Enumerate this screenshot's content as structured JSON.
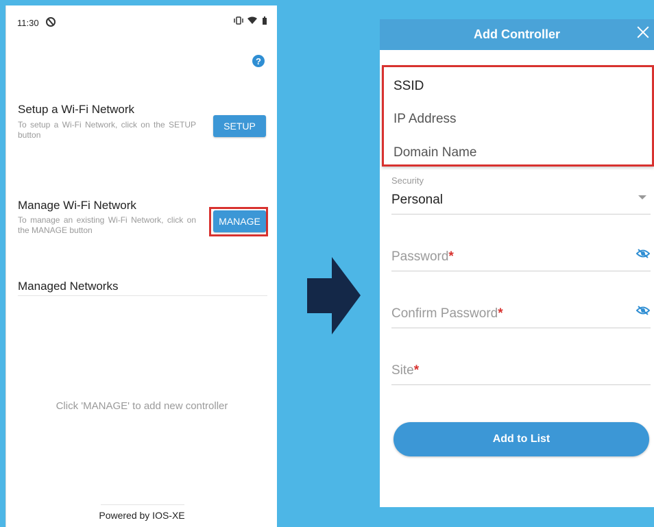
{
  "status_bar": {
    "time": "11:30",
    "icons": "vibrate wifi battery"
  },
  "setup_section": {
    "title": "Setup a Wi-Fi Network",
    "description": "To setup a Wi-Fi Network, click on the SETUP button",
    "button_label": "SETUP"
  },
  "manage_section": {
    "title": "Manage Wi-Fi Network",
    "description": "To manage an existing Wi-Fi Network, click on the MANAGE button",
    "button_label": "MANAGE"
  },
  "managed_networks": {
    "title": "Managed Networks",
    "empty_message": "Click 'MANAGE' to add new controller"
  },
  "footer": {
    "text": "Powered by IOS-XE"
  },
  "modal": {
    "title": "Add Controller",
    "dropdown_options": [
      "SSID",
      "IP Address",
      "Domain Name"
    ],
    "security": {
      "label": "Security",
      "value": "Personal"
    },
    "password": {
      "placeholder": "Password",
      "required_mark": "*"
    },
    "confirm_password": {
      "placeholder": "Confirm Password",
      "required_mark": "*"
    },
    "site": {
      "placeholder": "Site",
      "required_mark": "*"
    },
    "add_button": "Add to List"
  },
  "colors": {
    "background": "#4db6e6",
    "primary_button": "#3c97d6",
    "header": "#4aa3d8",
    "highlight": "#d8322f",
    "arrow": "#142848"
  }
}
